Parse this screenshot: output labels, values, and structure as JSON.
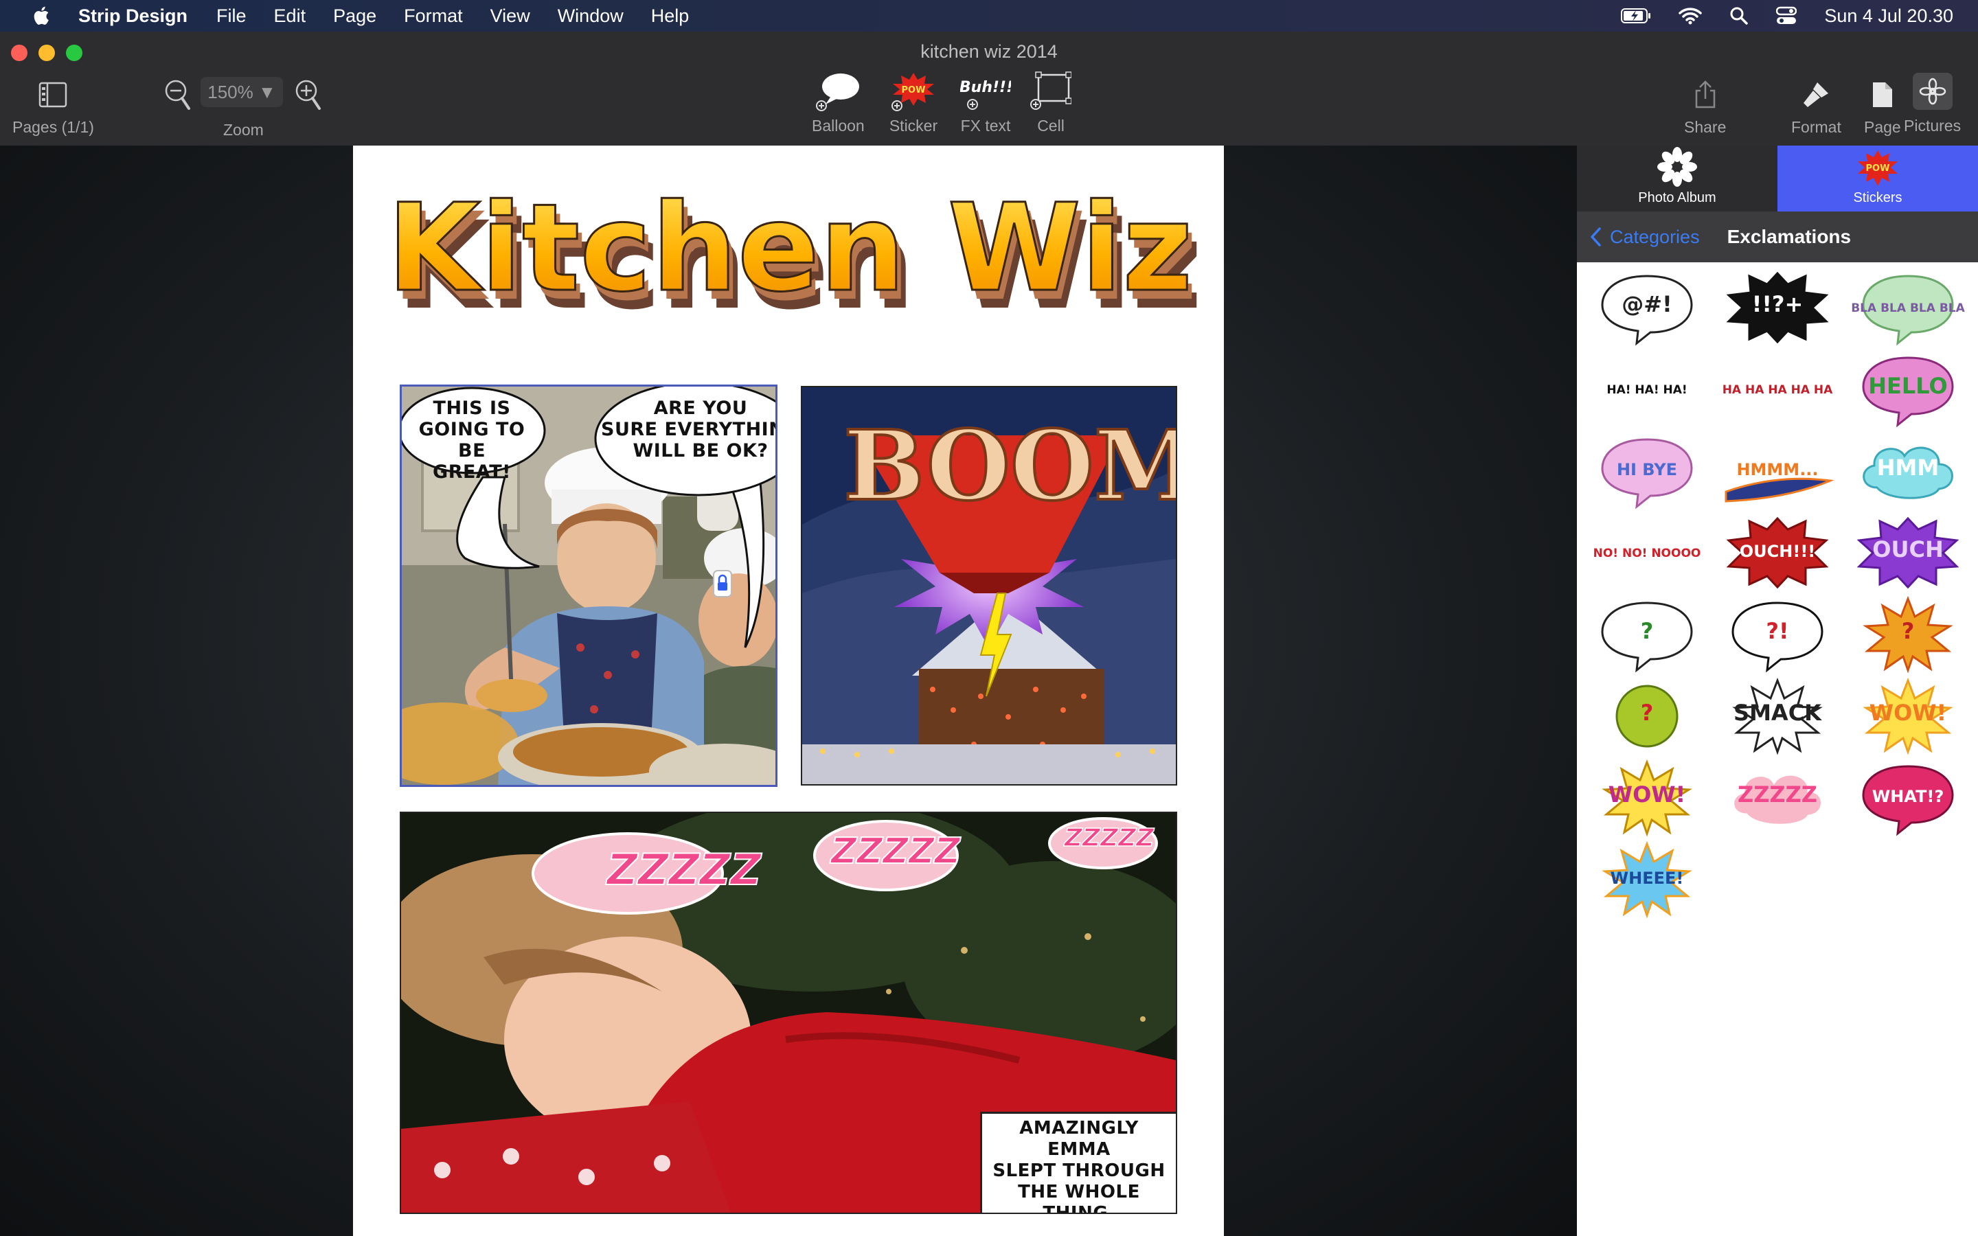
{
  "menubar": {
    "app_name": "Strip Design",
    "items": [
      "File",
      "Edit",
      "Page",
      "Format",
      "View",
      "Window",
      "Help"
    ],
    "clock": "Sun 4 Jul  20.30"
  },
  "window": {
    "title": "kitchen wiz 2014"
  },
  "toolbar": {
    "pages_label": "Pages (1/1)",
    "zoom_value": "150% ▼",
    "zoom_label": "Zoom",
    "balloon_label": "Balloon",
    "sticker_label": "Sticker",
    "sticker_icon_text": "POW",
    "fx_text_label": "FX text",
    "fx_icon_text": "Buh!!!",
    "cell_label": "Cell",
    "share_label": "Share",
    "format_label": "Format",
    "page_label": "Page",
    "pictures_label": "Pictures"
  },
  "page": {
    "title": "Kitchen Wiz",
    "panel1": {
      "balloon1": "THIS IS\nGOING TO BE\nGREAT!",
      "balloon2": "ARE YOU\nSURE EVERYTHING\nWILL BE OK?"
    },
    "panel2": {
      "fx_text": "BOOM"
    },
    "panel3": {
      "zzz": [
        "ZZZZZ",
        "ZZZZZ",
        "ZZZZZ"
      ],
      "caption": "AMAZINGLY EMMA\nSLEPT THROUGH\nTHE WHOLE\nTHING."
    }
  },
  "sidebar": {
    "tab_photo_album": "Photo Album",
    "tab_stickers": "Stickers",
    "tab_stickers_icon_text": "POW",
    "back_label": "Categories",
    "heading": "Exclamations",
    "stickers": [
      {
        "text": "@#!"
      },
      {
        "text": "!!?+"
      },
      {
        "text": "BLA BLA BLA BLA"
      },
      {
        "text": "HA! HA! HA!"
      },
      {
        "text": "HA HA HA HA HA"
      },
      {
        "text": "HELLO"
      },
      {
        "text": "HI BYE"
      },
      {
        "text": "HMMM..."
      },
      {
        "text": "HMM"
      },
      {
        "text": "NO! NO! NOOOO"
      },
      {
        "text": "OUCH!!!"
      },
      {
        "text": "OUCH"
      },
      {
        "text": "?"
      },
      {
        "text": "?!"
      },
      {
        "text": "?"
      },
      {
        "text": "?"
      },
      {
        "text": "SMACK"
      },
      {
        "text": "WOW!"
      },
      {
        "text": "WOW!"
      },
      {
        "text": "ZZZZZ"
      },
      {
        "text": "WHAT!?"
      },
      {
        "text": "WHEEE!"
      }
    ]
  }
}
